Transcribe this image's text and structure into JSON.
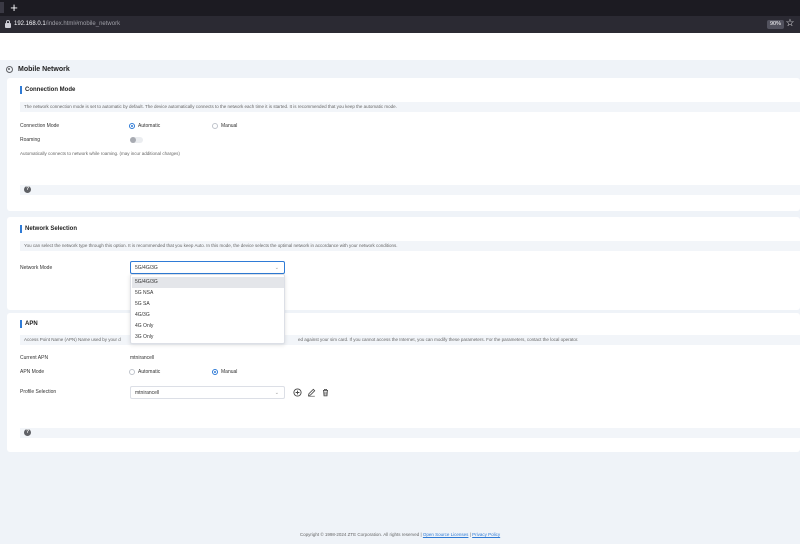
{
  "browser": {
    "url_host": "192.168.0.1",
    "url_path": "/index.html#mobile_network",
    "zoom": "90%"
  },
  "page": {
    "title": "Mobile Network"
  },
  "connection_mode": {
    "title": "Connection Mode",
    "description": "The network connection mode is set to automatic by default. The device automatically connects to the network each time it is started. It is recommended that you keep the automatic mode.",
    "connection_mode_label": "Connection Mode",
    "options": [
      "Automatic",
      "Manual"
    ],
    "selected": "Automatic",
    "roaming_label": "Roaming",
    "roaming_enabled": false,
    "roaming_note": "Automatically connects to network while roaming. (may incur additional charges)"
  },
  "network_selection": {
    "title": "Network Selection",
    "description": "You can select the network type through this option. It is recommended that you keep Auto. In this mode, the device selects the optimal network in accordance with your network conditions.",
    "network_mode_label": "Network Mode",
    "selected": "5G/4G/3G",
    "options": [
      "5G/4G/3G",
      "5G NSA",
      "5G SA",
      "4G/3G",
      "4G Only",
      "3G Only"
    ]
  },
  "apn": {
    "title": "APN",
    "description_left": "Access Point Name (APN) Name used by your d",
    "description_right": "ed against your sim card. If you cannot access the Internet, you can modify these parameters. For the parameters, contact the local operator.",
    "current_apn_label": "Current APN",
    "current_apn_value": "mtnirancell",
    "apn_mode_label": "APN Mode",
    "apn_mode_options": [
      "Automatic",
      "Manual"
    ],
    "apn_mode_selected": "Manual",
    "profile_selection_label": "Profile Selection",
    "profile_selected": "mtnirancell"
  },
  "footer": {
    "copyright": "Copyright © 1998-2024 ZTE Corporation. All rights reserved",
    "separator": "|",
    "open_source": "Open Source Licenses",
    "privacy": "Privacy Policy"
  }
}
